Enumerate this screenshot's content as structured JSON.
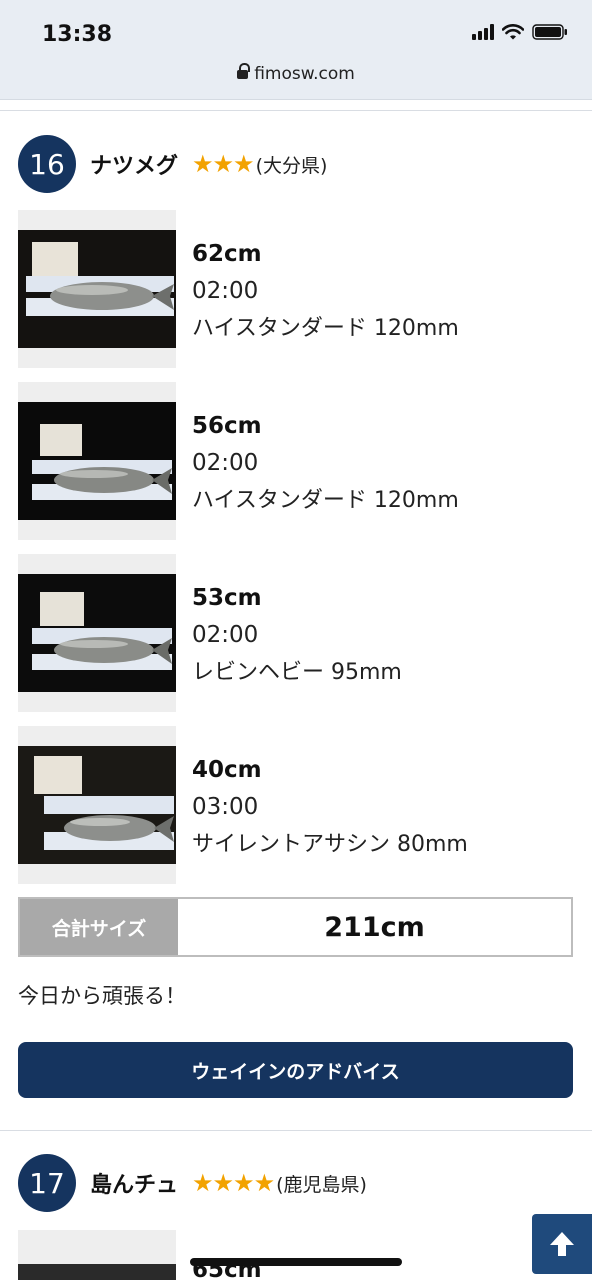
{
  "status_bar": {
    "time": "13:38"
  },
  "browser": {
    "url": "fimosw.com"
  },
  "entry": {
    "rank": "16",
    "name": "ナツメグ",
    "stars": "★★★",
    "prefecture": "(大分県)",
    "catches": [
      {
        "size": "62cm",
        "time": "02:00",
        "lure": "ハイスタンダード  120mm"
      },
      {
        "size": "56cm",
        "time": "02:00",
        "lure": "ハイスタンダード  120mm"
      },
      {
        "size": "53cm",
        "time": "02:00",
        "lure": "レビンヘビー  95mm"
      },
      {
        "size": "40cm",
        "time": "03:00",
        "lure": "サイレントアサシン  80mm"
      }
    ],
    "total_label": "合計サイズ",
    "total_value": "211cm",
    "comment": "今日から頑張る！",
    "advice_button": "ウェイインのアドバイス"
  },
  "next_entry": {
    "rank": "17",
    "name": "島んチュ",
    "stars": "★★★★",
    "prefecture": "(鹿児島県)",
    "first_size": "65cm"
  },
  "icons": {
    "signal": "cellular-signal-icon",
    "wifi": "wifi-icon",
    "battery": "battery-icon",
    "lock": "lock-icon",
    "scroll_top": "arrow-up-icon"
  },
  "colors": {
    "navy": "#15345f",
    "star": "#f2a200",
    "scroll_button": "#1f4a7c"
  }
}
